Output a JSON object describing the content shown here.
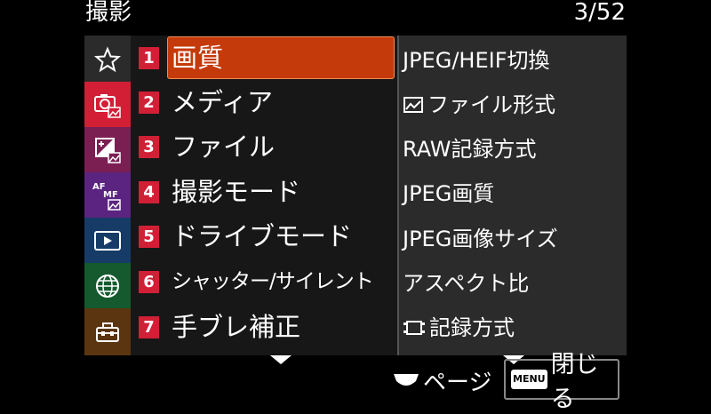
{
  "header": {
    "title": "撮影",
    "page_indicator": "3/52"
  },
  "sidebar": {
    "items": [
      {
        "icon": "star-icon",
        "color": "#2b2b2b"
      },
      {
        "icon": "camera-photo-icon",
        "color": "#d21f36"
      },
      {
        "icon": "exposure-photo-icon",
        "color": "#7b1f53"
      },
      {
        "icon": "af-mf-icon",
        "color": "#5a2480"
      },
      {
        "icon": "playback-icon",
        "color": "#173b67"
      },
      {
        "icon": "network-globe-icon",
        "color": "#145a2e"
      },
      {
        "icon": "toolbox-icon",
        "color": "#5a3510"
      }
    ]
  },
  "menu": {
    "items": [
      {
        "num": "1",
        "label": "画質",
        "selected": true
      },
      {
        "num": "2",
        "label": "メディア"
      },
      {
        "num": "3",
        "label": "ファイル"
      },
      {
        "num": "4",
        "label": "撮影モード"
      },
      {
        "num": "5",
        "label": "ドライブモード"
      },
      {
        "num": "6",
        "label": "シャッター/サイレント"
      },
      {
        "num": "7",
        "label": "手ブレ補正"
      }
    ]
  },
  "submenu": {
    "items": [
      {
        "label": "JPEG/HEIF切換"
      },
      {
        "label": "ファイル形式",
        "icon": "photo-frame-icon"
      },
      {
        "label": "RAW記録方式"
      },
      {
        "label": "JPEG画質"
      },
      {
        "label": "JPEG画像サイズ"
      },
      {
        "label": "アスペクト比"
      },
      {
        "label": "記録方式",
        "icon": "film-icon"
      }
    ]
  },
  "footer": {
    "page_label": "ページ",
    "menu_key": "MENU",
    "close_label": "閉じる"
  }
}
